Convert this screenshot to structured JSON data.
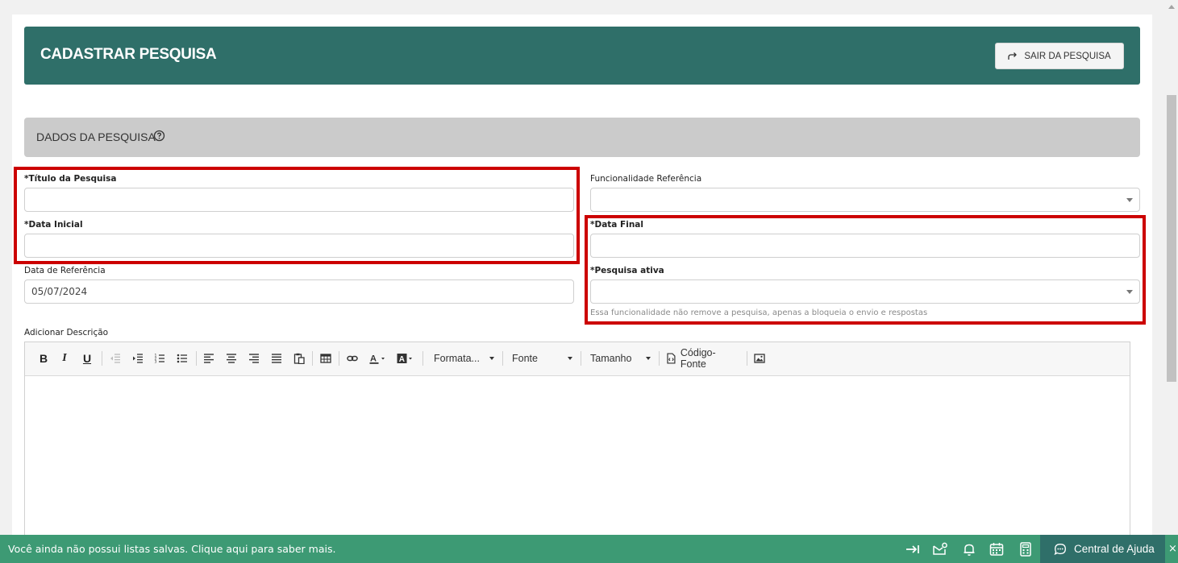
{
  "header": {
    "title": "CADASTRAR PESQUISA",
    "exit_button": "SAIR DA PESQUISA"
  },
  "section": {
    "title": "DADOS DA PESQUISA"
  },
  "form": {
    "titulo": {
      "label": "*Título da Pesquisa",
      "value": ""
    },
    "data_inicial": {
      "label": "*Data Inicial",
      "value": ""
    },
    "data_referencia": {
      "label": "Data de Referência",
      "value": "05/07/2024"
    },
    "funcionalidade": {
      "label": "Funcionalidade Referência",
      "value": ""
    },
    "data_final": {
      "label": "*Data Final",
      "value": ""
    },
    "pesquisa_ativa": {
      "label": "*Pesquisa ativa",
      "value": "",
      "hint": "Essa funcionalidade não remove a pesquisa, apenas a bloqueia o envio e respostas"
    },
    "descricao": {
      "label": "Adicionar Descrição"
    }
  },
  "editor": {
    "toolbar": {
      "bold": "B",
      "italic": "I",
      "underline": "U",
      "formats": "Formata...",
      "font": "Fonte",
      "size": "Tamanho",
      "source": "Código-Fonte"
    }
  },
  "footer": {
    "message": "Você ainda não possui listas salvas. Clique aqui para saber mais.",
    "help_center": "Central de Ajuda",
    "close": "×"
  },
  "colors": {
    "header_bg": "#2f6f69",
    "footer_bg": "#3d9a74",
    "highlight": "#cc0000",
    "section_bg": "#cbcbcb"
  }
}
